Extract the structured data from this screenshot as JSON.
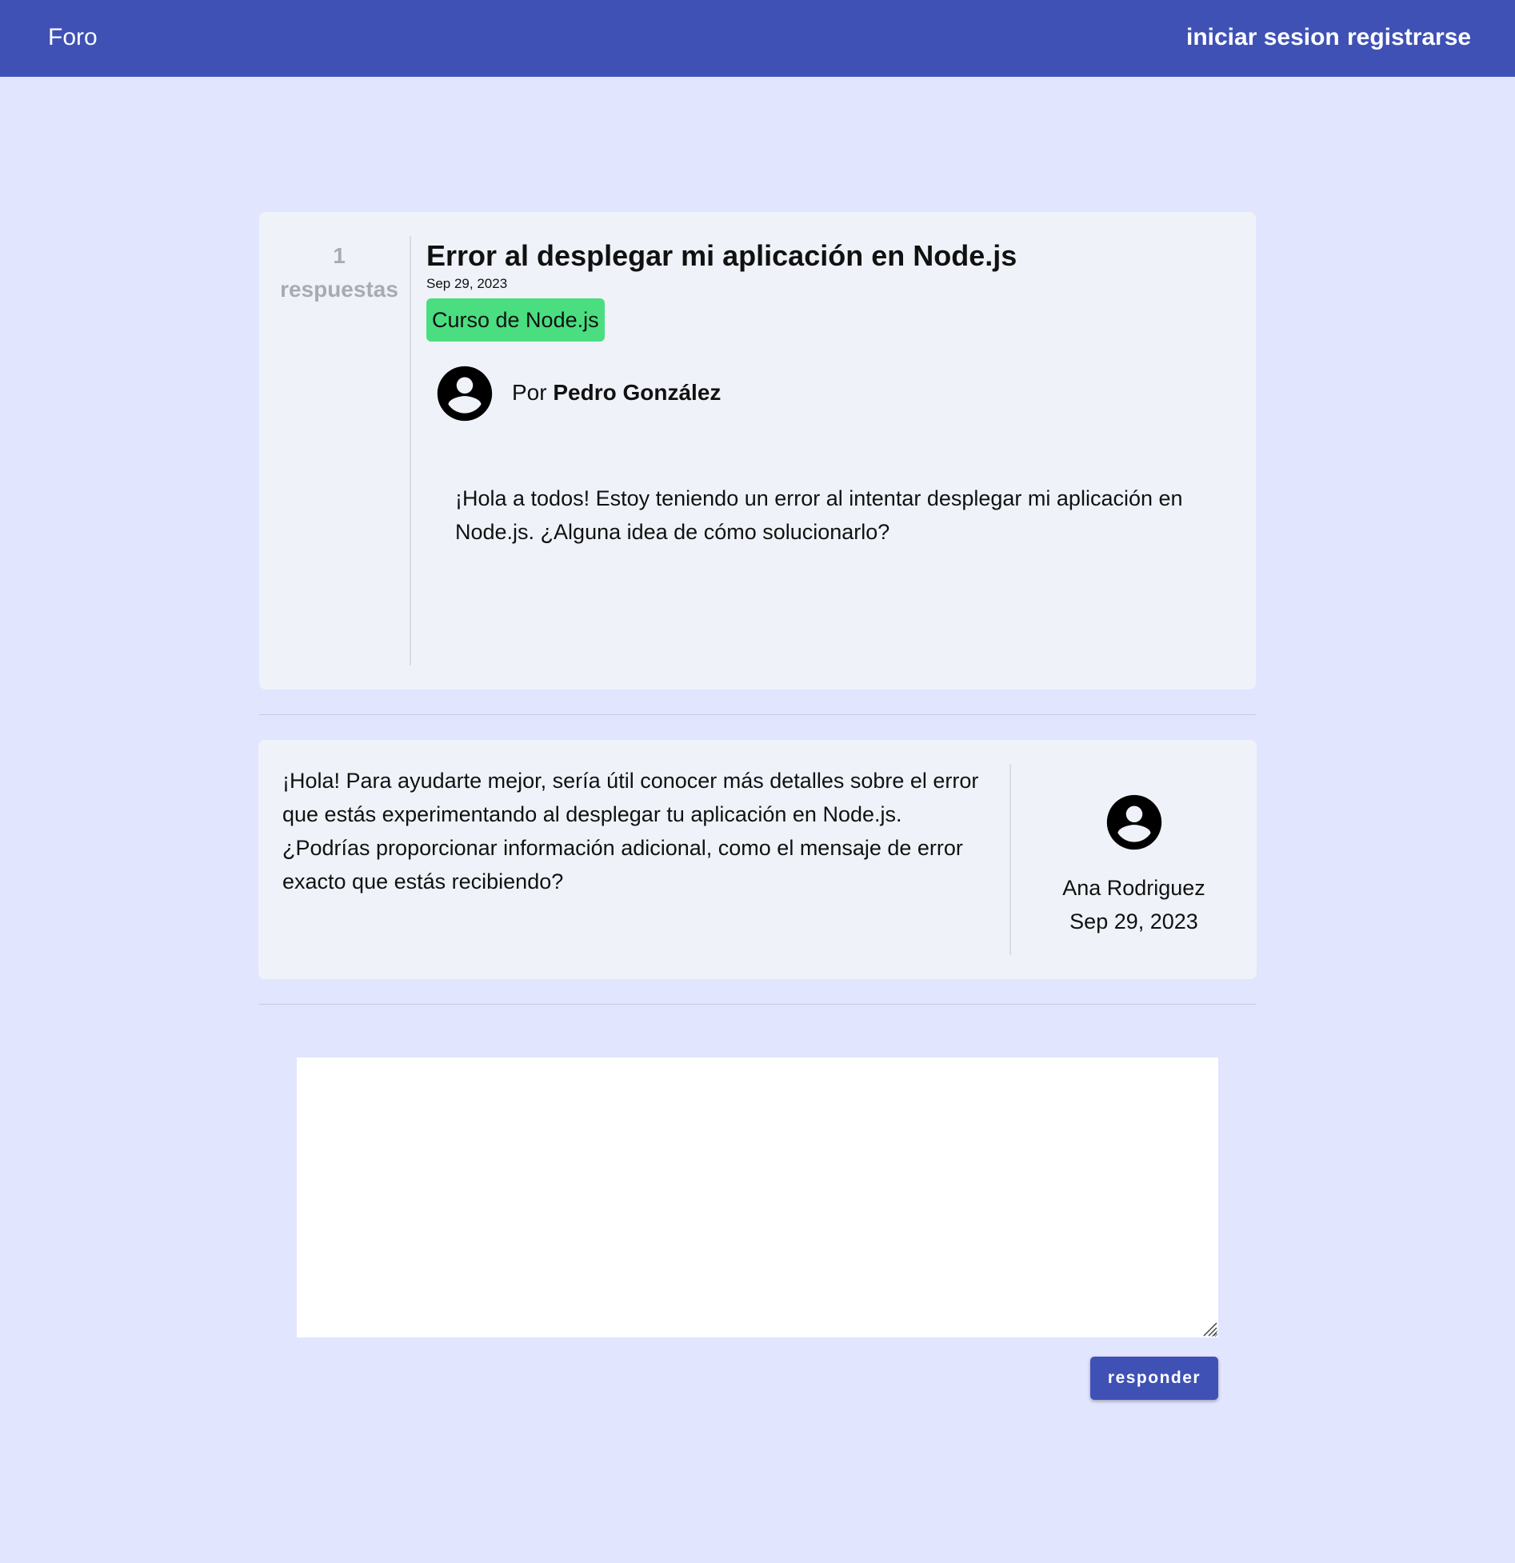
{
  "header": {
    "brand": "Foro",
    "login_label": "iniciar sesion",
    "register_label": "registrarse",
    "color": "#3f51b5"
  },
  "question": {
    "answer_count": "1",
    "answer_count_label": "respuestas",
    "title": "Error al desplegar mi aplicación en Node.js",
    "date": "Sep 29, 2023",
    "tag": "Curso de Node.js",
    "tag_color": "#4ade80",
    "author_prefix": "Por",
    "author_name": "Pedro González",
    "avatar_icon": "account-circle-icon",
    "body": "¡Hola a todos! Estoy teniendo un error al intentar desplegar mi aplicación en Node.js. ¿Alguna idea de cómo solucionarlo?"
  },
  "answers": [
    {
      "body": "¡Hola! Para ayudarte mejor, sería útil conocer más detalles sobre el error que estás experimentando al desplegar tu aplicación en Node.js. ¿Podrías proporcionar información adicional, como el mensaje de error exacto que estás recibiendo?",
      "author": "Ana Rodriguez",
      "date": "Sep 29, 2023",
      "avatar_icon": "account-circle-icon"
    }
  ],
  "reply": {
    "value": "",
    "button_label": "responder"
  }
}
